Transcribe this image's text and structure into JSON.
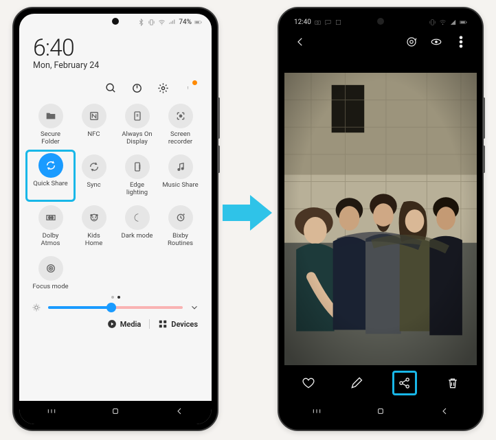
{
  "left": {
    "status": {
      "text": "74%",
      "icons": [
        "bluetooth",
        "vibrate",
        "wifi",
        "signal",
        "battery"
      ]
    },
    "time": "6:40",
    "date": "Mon, February 24",
    "toolbar": {
      "search": "search",
      "power": "power",
      "settings": "settings",
      "more": "more"
    },
    "tiles": [
      {
        "label": "Secure\nFolder",
        "icon": "folder"
      },
      {
        "label": "NFC",
        "icon": "nfc"
      },
      {
        "label": "Always On\nDisplay",
        "icon": "aod"
      },
      {
        "label": "Screen\nrecorder",
        "icon": "recorder"
      },
      {
        "label": "Quick Share",
        "icon": "quickshare",
        "active": true,
        "highlight": true
      },
      {
        "label": "Sync",
        "icon": "sync"
      },
      {
        "label": "Edge\nlighting",
        "icon": "edge"
      },
      {
        "label": "Music Share",
        "icon": "music"
      },
      {
        "label": "Dolby\nAtmos",
        "icon": "dolby"
      },
      {
        "label": "Kids\nHome",
        "icon": "kids"
      },
      {
        "label": "Dark mode",
        "icon": "dark"
      },
      {
        "label": "Bixby\nRoutines",
        "icon": "bixby"
      },
      {
        "label": "Focus mode",
        "icon": "focus"
      }
    ],
    "brightness_pct": 47,
    "footer": {
      "media": "Media",
      "devices": "Devices"
    }
  },
  "right": {
    "status": {
      "time": "12:40",
      "icons_left": [
        "camera",
        "message",
        "square"
      ],
      "icons_right": [
        "vibrate",
        "wifi",
        "signal",
        "battery"
      ]
    },
    "top_actions": {
      "back": "back",
      "bixby": "bixby-vision",
      "view": "view",
      "more": "more"
    },
    "bottom_actions": {
      "favorite": "favorite",
      "edit": "edit",
      "share": "share",
      "delete": "delete"
    },
    "highlighted": "share"
  },
  "colors": {
    "accent": "#1a9bff",
    "highlight": "#18b7e8",
    "arrow": "#2fc3e8"
  }
}
